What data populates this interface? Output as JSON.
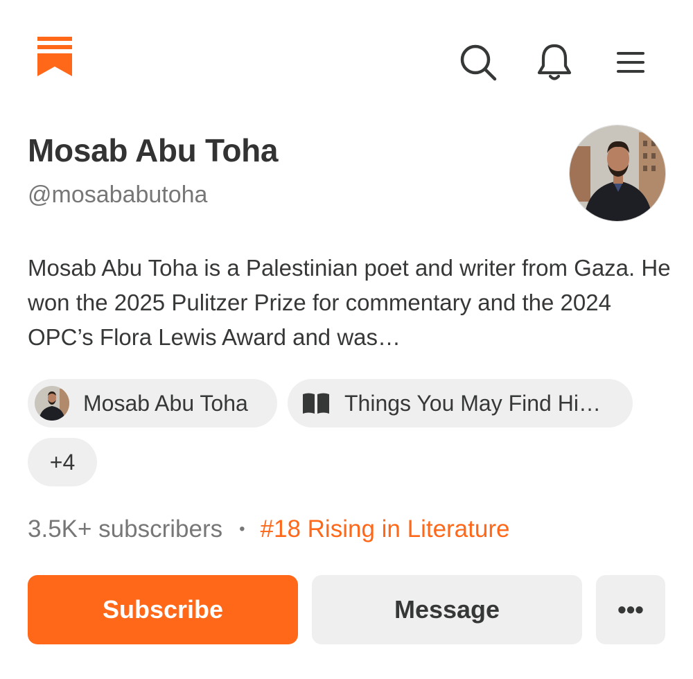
{
  "header": {
    "logo_icon": "substack-bookmark-logo",
    "search_icon": "search-icon",
    "notifications_icon": "bell-icon",
    "menu_icon": "hamburger-menu-icon"
  },
  "profile": {
    "name": "Mosab Abu Toha",
    "handle": "@mosababutoha",
    "bio": "Mosab Abu Toha is a Palestinian poet and writer from Gaza. He won the 2025 Pulitzer Prize for commentary and the 2024 OPC’s Flora Lewis Award and was…"
  },
  "chips": {
    "author": "Mosab Abu Toha",
    "publication": "Things You May Find Hi…",
    "publication_icon": "book-icon",
    "more": "+4"
  },
  "stats": {
    "subscribers": "3.5K+ subscribers",
    "separator": "•",
    "rank": "#18 Rising in Literature"
  },
  "actions": {
    "subscribe": "Subscribe",
    "message": "Message",
    "more": "•••"
  },
  "colors": {
    "accent": "#ff6719",
    "text": "#363737",
    "muted": "#777777",
    "chip_bg": "#efefef"
  }
}
